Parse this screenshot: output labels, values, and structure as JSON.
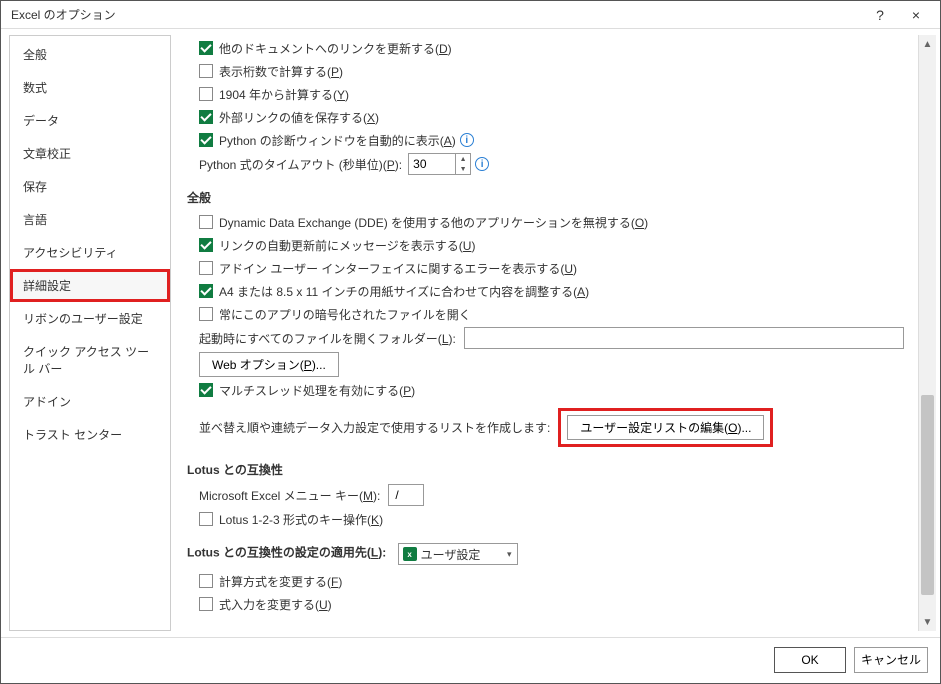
{
  "window": {
    "title": "Excel のオプション",
    "help": "?",
    "close": "×"
  },
  "sidebar": {
    "items": [
      {
        "label": "全般"
      },
      {
        "label": "数式"
      },
      {
        "label": "データ"
      },
      {
        "label": "文章校正"
      },
      {
        "label": "保存"
      },
      {
        "label": "言語"
      },
      {
        "label": "アクセシビリティ"
      },
      {
        "label": "詳細設定",
        "active": true
      },
      {
        "label": "リボンのユーザー設定"
      },
      {
        "label": "クイック アクセス ツール バー"
      },
      {
        "label": "アドイン"
      },
      {
        "label": "トラスト センター"
      }
    ]
  },
  "checkboxes": {
    "c0": {
      "checked": true,
      "label": "他のドキュメントへのリンクを更新する(",
      "k": "D",
      "after": ")"
    },
    "c1": {
      "checked": false,
      "label": "表示桁数で計算する(",
      "k": "P",
      "after": ")"
    },
    "c2": {
      "checked": false,
      "label": "1904 年から計算する(",
      "k": "Y",
      "after": ")"
    },
    "c3": {
      "checked": true,
      "label": "外部リンクの値を保存する(",
      "k": "X",
      "after": ")"
    },
    "c4": {
      "checked": true,
      "label": "Python の診断ウィンドウを自動的に表示(",
      "k": "A",
      "after": ")"
    },
    "c5": {
      "checked": false,
      "label": "Dynamic Data Exchange (DDE) を使用する他のアプリケーションを無視する(",
      "k": "O",
      "after": ")"
    },
    "c6": {
      "checked": true,
      "label": "リンクの自動更新前にメッセージを表示する(",
      "k": "U",
      "after": ")"
    },
    "c7": {
      "checked": false,
      "label": "アドイン ユーザー インターフェイスに関するエラーを表示する(",
      "k": "U",
      "after": ")"
    },
    "c8": {
      "checked": true,
      "label": "A4 または 8.5 x 11 インチの用紙サイズに合わせて内容を調整する(",
      "k": "A",
      "after": ")"
    },
    "c9": {
      "checked": false,
      "label": "常にこのアプリの暗号化されたファイルを開く"
    },
    "c10": {
      "checked": true,
      "label": "マルチスレッド処理を有効にする(",
      "k": "P",
      "after": ")"
    },
    "c11": {
      "checked": false,
      "label": "Lotus 1-2-3 形式のキー操作(",
      "k": "K",
      "after": ")"
    },
    "c12": {
      "checked": false,
      "label": "計算方式を変更する(",
      "k": "F",
      "after": ")"
    },
    "c13": {
      "checked": false,
      "label": "式入力を変更する(",
      "k": "U",
      "after": ")"
    }
  },
  "timeout": {
    "label_pre": "Python 式のタイムアウト (秒単位)(",
    "k": "P",
    "label_post": "):",
    "value": "30"
  },
  "sections": {
    "general": "全般",
    "lotus": "Lotus との互換性",
    "lotus_apply_pre": "Lotus との互換性の設定の適用先(",
    "lotus_apply_k": "L",
    "lotus_apply_post": "):"
  },
  "startup": {
    "label_pre": "起動時にすべてのファイルを開くフォルダー(",
    "k": "L",
    "label_post": "):",
    "value": ""
  },
  "weboptions": {
    "label_pre": "Web オプション(",
    "k": "P",
    "label_post": ")..."
  },
  "customlist": {
    "label": "並べ替え順や連続データ入力設定で使用するリストを作成します:",
    "btn_pre": "ユーザー設定リストの編集(",
    "btn_k": "O",
    "btn_post": ")..."
  },
  "menukey": {
    "label_pre": "Microsoft Excel メニュー キー(",
    "k": "M",
    "label_post": "):",
    "value": "/"
  },
  "lotus_select": {
    "value": "ユーザ設定"
  },
  "footer": {
    "ok": "OK",
    "cancel": "キャンセル"
  }
}
